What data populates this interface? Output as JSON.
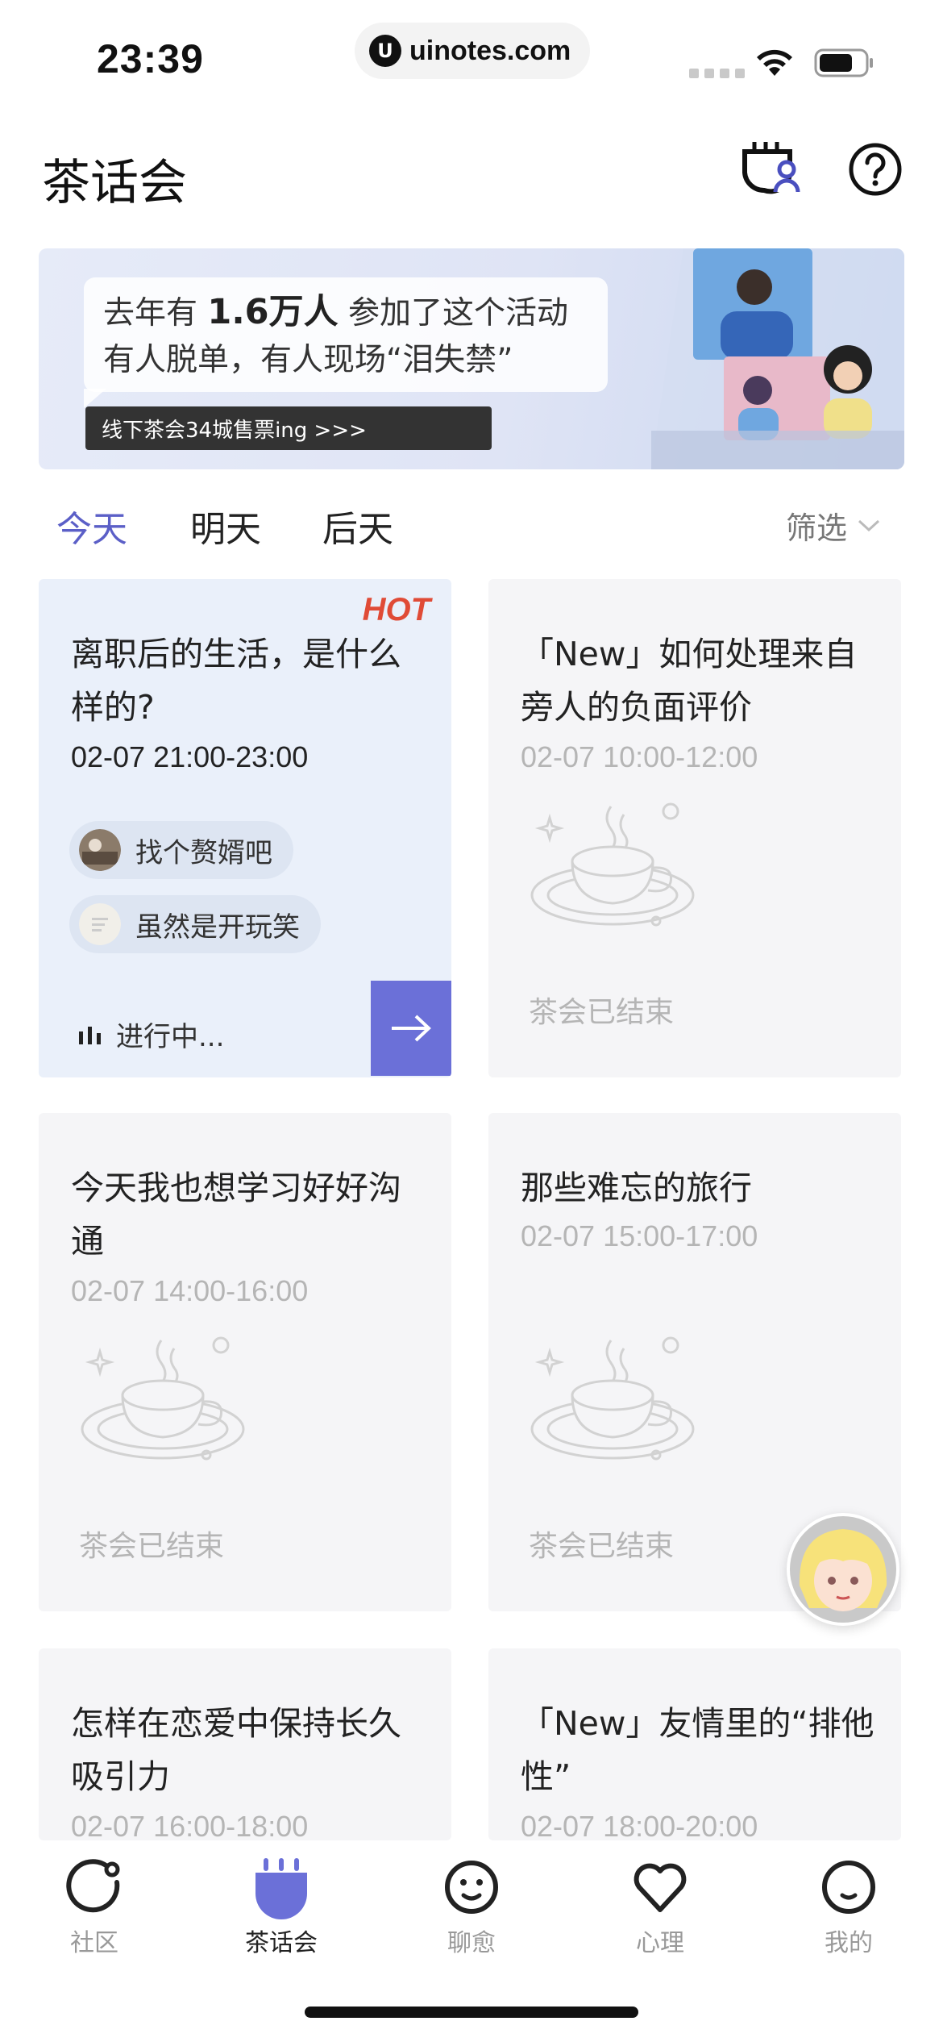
{
  "status_bar": {
    "time": "23:39",
    "url": "uinotes.com",
    "url_logo": "U"
  },
  "header": {
    "title": "茶话会"
  },
  "banner": {
    "line1_prefix": "去年有",
    "line1_highlight": "1.6万人",
    "line1_suffix": "参加了这个活动",
    "line2": "有人脱单，有人现场“泪失禁”",
    "cta": "线下茶会34城售票ing >>>"
  },
  "tabs": [
    {
      "label": "今天",
      "active": true
    },
    {
      "label": "明天",
      "active": false
    },
    {
      "label": "后天",
      "active": false
    }
  ],
  "filter_label": "筛选",
  "cards": [
    {
      "hot_label": "HOT",
      "title": "离职后的生活，是什么样的?",
      "time": "02-07 21:00-23:00",
      "chips": [
        "找个赘婿吧",
        "虽然是开玩笑"
      ],
      "status": "进行中..."
    },
    {
      "title": "「New」如何处理来自旁人的负面评价",
      "time": "02-07 10:00-12:00",
      "status": "茶会已结束"
    },
    {
      "title": "今天我也想学习好好沟通",
      "time": "02-07 14:00-16:00",
      "status": "茶会已结束"
    },
    {
      "title": "那些难忘的旅行",
      "time": "02-07 15:00-17:00",
      "status": "茶会已结束"
    },
    {
      "title": "怎样在恋爱中保持长久吸引力",
      "time": "02-07 16:00-18:00"
    },
    {
      "title": "「New」友情里的“排他性”",
      "time": "02-07 18:00-20:00"
    }
  ],
  "nav": [
    {
      "label": "社区",
      "icon": "community-icon"
    },
    {
      "label": "茶话会",
      "icon": "tea-party-icon",
      "active": true
    },
    {
      "label": "聊愈",
      "icon": "chat-heal-icon"
    },
    {
      "label": "心理",
      "icon": "heart-icon"
    },
    {
      "label": "我的",
      "icon": "profile-icon"
    }
  ],
  "colors": {
    "accent": "#5b5fc7",
    "button": "#6b70d8",
    "hot": "#e04b36",
    "card_bg": "#f5f5f7",
    "hot_card_bg": "#eaf0fa"
  }
}
